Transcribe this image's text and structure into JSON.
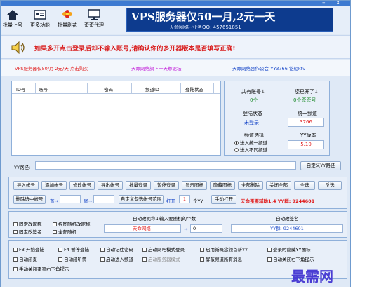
{
  "titlebar": {
    "minimize": "–",
    "close": "x"
  },
  "toolbar": [
    {
      "label": "批量上号",
      "icon": "home-icon"
    },
    {
      "label": "更多功能",
      "icon": "id-card-icon"
    },
    {
      "label": "批量刷花",
      "icon": "flower-icon"
    },
    {
      "label": "歪歪代理",
      "icon": "monitor-icon"
    }
  ],
  "banner": {
    "headline": "VPS服务器仅50一月,2元一天",
    "sub": "天命网络--业务QQ: 457651851"
  },
  "notice": {
    "icon": "speaker-icon",
    "text": "如果多开点击登录后却不输入账号,请确认你的多开器版本是否填写正确!"
  },
  "links": {
    "left": "VPS服务器仅50/月 2元/天 点击购买",
    "middle": "天命网络旗下一天尊论坛",
    "right": "天命网络合作公会-YY3766 铭船ktv"
  },
  "table": {
    "columns": [
      "ID号",
      "账号",
      "密码",
      "频道ID",
      "登陆状态"
    ]
  },
  "info": {
    "total_label": "共有账号↓",
    "total_value": "0个",
    "open_label": "您已开了↓",
    "open_value": "0个歪歪号",
    "login_label": "登陆状态",
    "login_value": "未登录",
    "channel_label": "统一频道",
    "channel_value": "3766",
    "select_label": "频道选择",
    "radio_same": "进入统一频道",
    "radio_diff": "进入不同频道",
    "version_label": "YY版本",
    "version_value": "5.10"
  },
  "path": {
    "label": "YY路径:",
    "value": "",
    "button": "自定义YY路径"
  },
  "buttons": [
    "导入帐号",
    "添加帐号",
    "修改帐号",
    "导出帐号",
    "批量登录",
    "暂停登录",
    "显示图标",
    "隐藏图标",
    "全部删除",
    "关闭全部",
    "全选",
    "反选"
  ],
  "row2": {
    "delete_selected": "删除选中帐号",
    "first_label": "首→",
    "first_value": "",
    "tail_label": "尾→",
    "tail_value": "",
    "custom_range": "自定义勾选帐号范围",
    "open_label": "打开",
    "open_value": "1",
    "unit": "个YY",
    "manual_open": "手动打开",
    "promo": "天命歪歪辅助1.4 YY群: 9244601"
  },
  "nick_group": {
    "title": "自动改昵称↓输入要随机的个数",
    "fixed_nick": "固定改昵称",
    "random_nick": "描图随机改昵称",
    "fixed_sign": "固定改签名",
    "all_random": "全部随机",
    "nick_value": "天命网络-",
    "count_value": "0"
  },
  "sign_group": {
    "title": "自动改签名",
    "value": "YY群: 9244601"
  },
  "options": [
    [
      "F3 开始登陆",
      "F4 暂停登陆",
      "自动记住密码",
      "启动网吧模式登录",
      "启用新概念领首新YY",
      "登录时隐藏YY图标"
    ],
    [
      "自动闭麦",
      "自动闭听筒",
      "启动进入频道",
      "启动服务器模式",
      "屏蔽频道所有消息",
      "自动关闭右下角提示"
    ],
    [
      "手动关闭歪歪右下角提示"
    ]
  ],
  "watermark": "最需网"
}
